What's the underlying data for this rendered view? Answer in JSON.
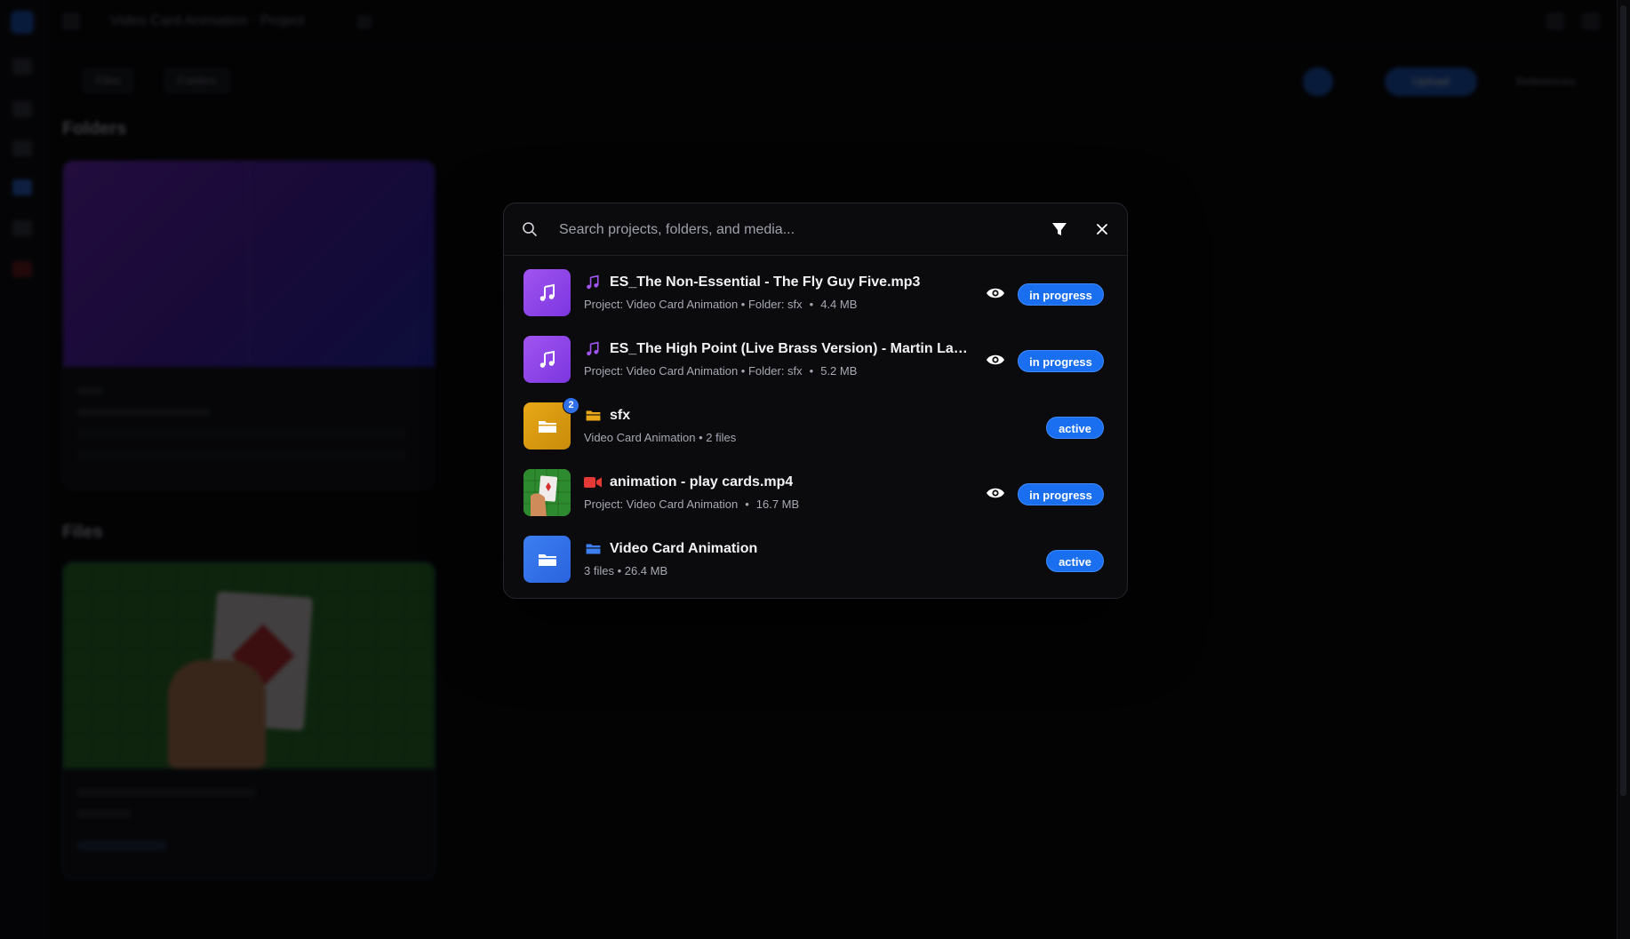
{
  "background": {
    "window_title": "Video Card Animation · Project",
    "toolbar_tabs": [
      "Files",
      "Folders"
    ],
    "upload_label": "Upload",
    "references_label": "References",
    "sections": [
      "Folders",
      "Files"
    ],
    "folder_card": {
      "name": "sfx",
      "project": "Video Card Animation",
      "count": "2 files"
    },
    "file_card": {
      "name": "animation - play cards.mp4",
      "status": "In Progress"
    }
  },
  "search": {
    "placeholder": "Search projects, folders, and media...",
    "value": "",
    "filter_icon": "filter-icon",
    "close_icon": "close-icon"
  },
  "results": [
    {
      "kind": "audio",
      "icon": "music-note-icon",
      "title": "ES_The Non-Essential - The Fly Guy Five.mp3",
      "meta_main": "Project: Video Card Animation • Folder: sfx",
      "meta_size": "4.4 MB",
      "status": "in progress",
      "previewable": true
    },
    {
      "kind": "audio",
      "icon": "music-note-icon",
      "title": "ES_The High Point (Live Brass Version) - Martin Landstr...",
      "meta_main": "Project: Video Card Animation • Folder: sfx",
      "meta_size": "5.2 MB",
      "status": "in progress",
      "previewable": true
    },
    {
      "kind": "folder",
      "icon": "folder-icon",
      "title": "sfx",
      "meta_main": "Video Card Animation • 2 files",
      "count_badge": "2",
      "status": "active",
      "previewable": false
    },
    {
      "kind": "video",
      "icon": "video-camera-icon",
      "title": "animation - play cards.mp4",
      "meta_main": "Project: Video Card Animation",
      "meta_size": "16.7 MB",
      "status": "in progress",
      "previewable": true
    },
    {
      "kind": "project",
      "icon": "project-folder-icon",
      "title": "Video Card Animation",
      "meta_main": "3 files • 26.4 MB",
      "status": "active",
      "previewable": false
    }
  ],
  "colors": {
    "accent_blue": "#1a6ff0",
    "audio_purple": "#8b45e8",
    "folder_yellow": "#e8a817",
    "video_red": "#e53935",
    "project_blue": "#3c7ff2"
  }
}
